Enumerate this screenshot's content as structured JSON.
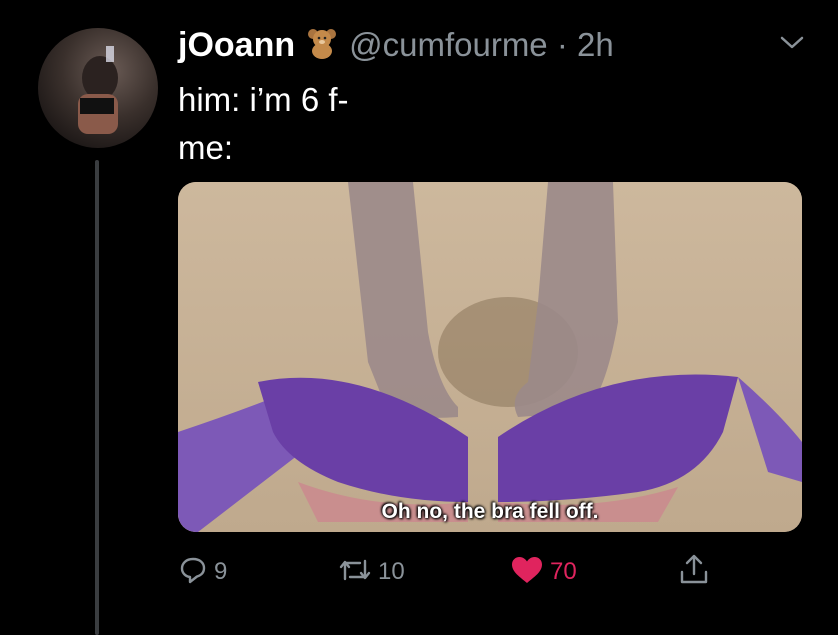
{
  "tweet": {
    "display_name": "jOoann",
    "handle_time": "@cumfourme · 2h",
    "lines": [
      "him: i’m 6 f-",
      "me:"
    ],
    "media": {
      "caption": "Oh no, the bra fell off."
    },
    "actions": {
      "replies": "9",
      "retweets": "10",
      "likes": "70"
    }
  },
  "colors": {
    "background": "#000000",
    "muted": "#8a9299",
    "like": "#e0245e"
  },
  "icons": [
    "teddy-bear-icon",
    "chevron-down-icon",
    "reply-icon",
    "retweet-icon",
    "heart-icon",
    "share-icon"
  ]
}
